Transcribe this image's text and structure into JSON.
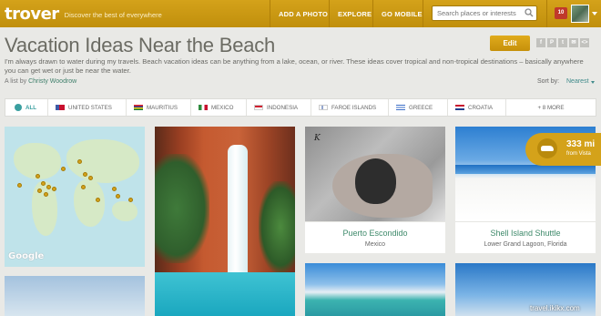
{
  "header": {
    "logo": "trover",
    "tagline": "Discover the best of everywhere",
    "nav": [
      "ADD A PHOTO",
      "EXPLORE",
      "GO MOBILE"
    ],
    "search_placeholder": "Search places or interests",
    "notification_count": "10"
  },
  "page": {
    "title": "Vacation Ideas Near the Beach",
    "edit_label": "Edit",
    "share_icons": [
      "f",
      "P",
      "t",
      "✉",
      "<>"
    ],
    "description": "I'm always drawn to water during my travels. Beach vacation ideas can be anything from a lake, ocean, or river. These ideas cover tropical and non-tropical destinations – basically anywhere you can get wet or just be near the water.",
    "byline_prefix": "A list by",
    "author": "Christy Woodrow",
    "sort_label": "Sort by:",
    "sort_value": "Nearest"
  },
  "filters": [
    {
      "label": "ALL"
    },
    {
      "label": "UNITED STATES"
    },
    {
      "label": "MAURITIUS"
    },
    {
      "label": "MEXICO"
    },
    {
      "label": "INDONESIA"
    },
    {
      "label": "FAROE ISLANDS"
    },
    {
      "label": "GREECE"
    },
    {
      "label": "CROATIA"
    },
    {
      "label": "+ 8 MORE"
    }
  ],
  "flag_colors": {
    "us": "#3c5aa6",
    "mauritius": "#1a7a3c",
    "mexico": "#2e8b3e",
    "indonesia": "#d02030",
    "faroe": "#2a4c9c",
    "greece": "#3d6fc8",
    "croatia": "#c8102e"
  },
  "map": {
    "google_label": "Google"
  },
  "cards": [
    {
      "title": "Puerto Escondido",
      "subtitle": "Mexico"
    },
    {
      "title": "Shell Island Shuttle",
      "subtitle": "Lower Grand Lagoon, Florida"
    }
  ],
  "turtle_card": {
    "ink_text": "K"
  },
  "distance_badge": {
    "miles": "333 mi",
    "from": "from Vista"
  },
  "accent_color": "#d4a21a",
  "link_color": "#3f8a6b",
  "watermark": "travel.ikikx.com"
}
